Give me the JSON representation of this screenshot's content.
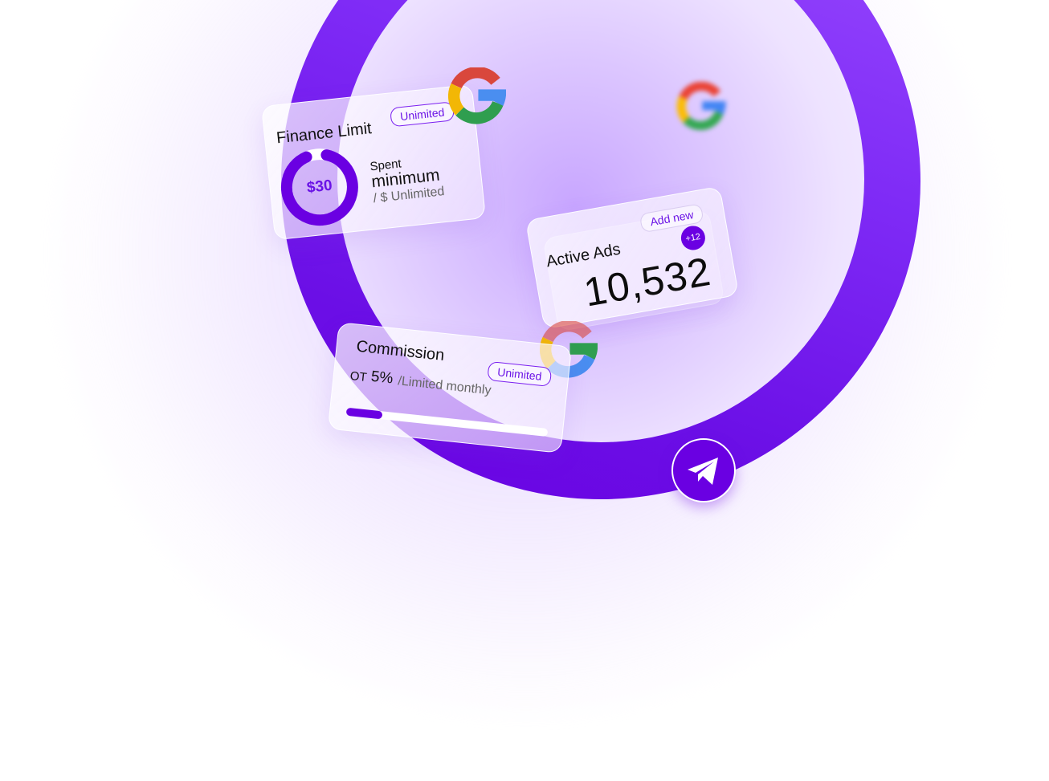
{
  "colors": {
    "accent": "#6a00e2",
    "accent_light": "#9a4dff",
    "background": "#ffffff"
  },
  "finance_card": {
    "title": "Finance Limit",
    "badge": "Unimited",
    "donut_value": "$30",
    "donut_fill_fraction": 0.9,
    "spent_label": "Spent",
    "spent_value": "minimum",
    "spent_limit": "/ $ Unlimited"
  },
  "active_ads_card": {
    "title": "Active Ads",
    "add_button": "Add new",
    "count_badge": "+12",
    "value": "10,532"
  },
  "commission_card": {
    "title": "Commission",
    "badge": "Unimited",
    "prefix": "OT",
    "percent": "5%",
    "suffix": "/Limited monthly",
    "progress_fraction": 0.18
  },
  "icons": {
    "google": "google-g-icon",
    "telegram": "telegram-plane-icon"
  }
}
